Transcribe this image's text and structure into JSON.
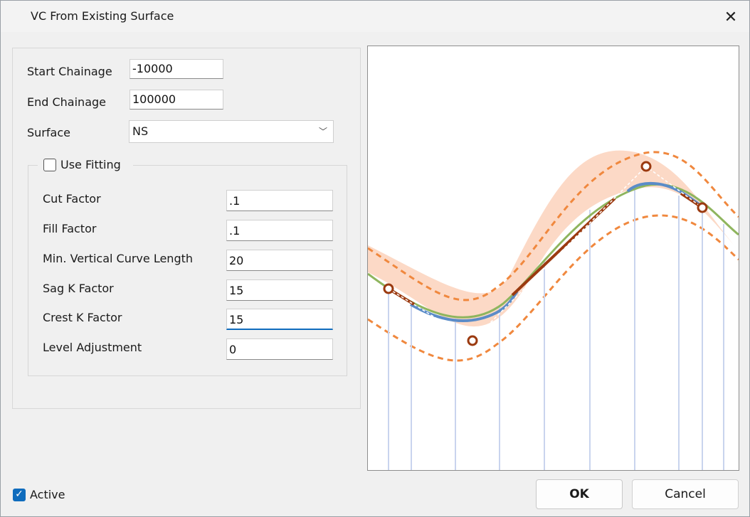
{
  "window": {
    "title": "VC From Existing Surface",
    "close_glyph": "✕"
  },
  "form": {
    "start_chainage": {
      "label": "Start Chainage",
      "value": "-10000"
    },
    "end_chainage": {
      "label": "End Chainage",
      "value": "100000"
    },
    "surface": {
      "label": "Surface",
      "value": "NS",
      "arrow": "﹀"
    }
  },
  "fitting": {
    "label": "Use Fitting",
    "checked": false,
    "cut_factor": {
      "label": "Cut Factor",
      "value": ".1"
    },
    "fill_factor": {
      "label": "Fill Factor",
      "value": ".1"
    },
    "min_vc_length": {
      "label": "Min. Vertical Curve Length",
      "value": "20"
    },
    "sag_k": {
      "label": "Sag K Factor",
      "value": "15"
    },
    "crest_k": {
      "label": "Crest K Factor",
      "value": "15"
    },
    "level_adjustment": {
      "label": "Level Adjustment",
      "value": "0"
    }
  },
  "preview": {
    "colors": {
      "band_fill": "#fcd9c6",
      "band_edge": "#f0883e",
      "surface": "#8fb55e",
      "vertical_curve": "#5b8cc8",
      "tangent": "#9b3a10",
      "control_point": "#9b3a10",
      "grid": "#c9d4ee"
    },
    "icon": "vertical-curve-preview-icon"
  },
  "footer": {
    "active_label": "Active",
    "active_checked": true,
    "ok_label": "OK",
    "cancel_label": "Cancel"
  }
}
